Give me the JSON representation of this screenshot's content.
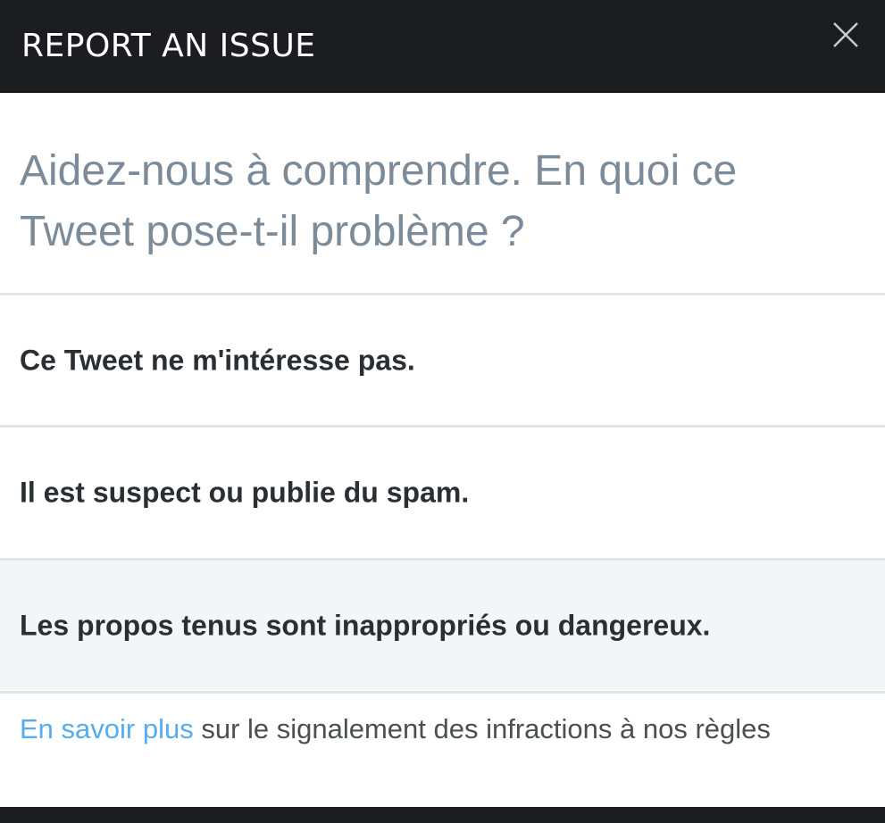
{
  "header": {
    "title": "REPORT AN ISSUE",
    "close_icon": "close-icon"
  },
  "question": "Aidez-nous à comprendre. En quoi ce Tweet pose-t-il problème ?",
  "options": [
    {
      "label": "Ce Tweet ne m'intéresse pas.",
      "highlighted": false
    },
    {
      "label": "Il est suspect ou publie du spam.",
      "highlighted": false
    },
    {
      "label": "Les propos tenus sont inappropriés ou dangereux.",
      "highlighted": true
    }
  ],
  "footer": {
    "link_text": "En savoir plus",
    "text": " sur le signalement des infractions à nos règles"
  },
  "colors": {
    "header_bg": "#1c1d20",
    "question_text": "#7c8b9a",
    "link": "#55acee",
    "highlight_bg": "#f3f6f9",
    "divider": "#e1e6eb"
  }
}
